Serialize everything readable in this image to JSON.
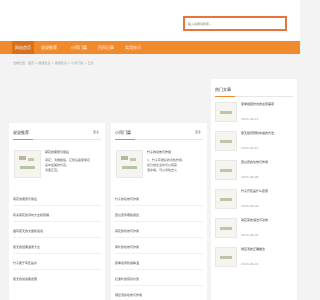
{
  "header": {
    "search_placeholder": "输入关键词搜索..."
  },
  "nav": {
    "items": [
      {
        "label": "网站首页",
        "active": true
      },
      {
        "label": "说说推荐",
        "active": false
      },
      {
        "label": "小窍门篇",
        "active": false
      },
      {
        "label": "百科记事",
        "active": false
      },
      {
        "label": "实用技巧",
        "active": false
      }
    ]
  },
  "breadcrumb": "当前位置：首页 > 健康生活 > 健康知识 > 小窍门篇 > 正文",
  "left_panel": {
    "title": "说说推荐",
    "more": "更多",
    "featured_title": "荷花的寓意与象征",
    "featured_desc": [
      "荷花：清雅脱俗，它象征着夏季花",
      "朵中最美的代表。",
      "清廉正直。"
    ],
    "list": [
      "荷花的寓意与象征",
      "有关荷花的诗句大全和祝福",
      "描写夏天的文章和说说",
      "夏天的经典语录大全",
      "竹子属于草还是木",
      "夏天的说说朋友圈"
    ]
  },
  "mid_panel": {
    "title": "小窍门篇",
    "more": "更多",
    "featured_title": "竹子的功效与作用",
    "featured_desc": [
      "1、竹子有很好的清热作用，",
      "在日常生活中可以用来",
      "泡水喝，可以清热去火"
    ],
    "list": [
      "竹子的功效与作用",
      "西瓜皮有哪些用途",
      "荷花的功效与作用",
      "荷叶的功效与作用",
      "夏季如何防暑降温",
      "红薯叶的营养价值",
      "绿豆汤的功效与作用"
    ]
  },
  "right_panel": {
    "title": "热门文章",
    "items": [
      {
        "title": "夏季健康饮食的注意事项",
        "date": "2024-06-12"
      },
      {
        "title": "夏天如何预防中暑的方法",
        "date": "2024-06-10"
      },
      {
        "title": "西瓜皮的功效与作用",
        "date": "2024-06-08"
      },
      {
        "title": "竹子开花是什么原因",
        "date": "2024-06-06"
      },
      {
        "title": "荷花茶的泡法与功效",
        "date": "2024-06-04"
      },
      {
        "title": "绿豆汤的正确做法",
        "date": "2024-06-02"
      }
    ]
  }
}
